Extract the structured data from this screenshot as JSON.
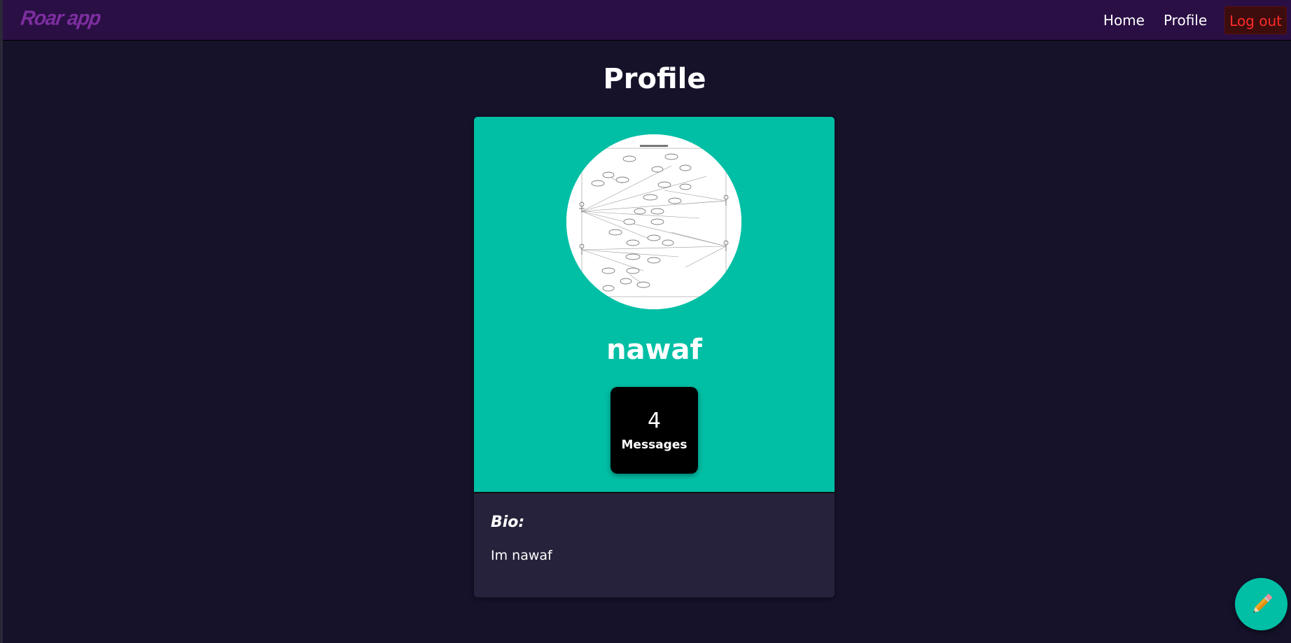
{
  "navbar": {
    "brand": "Roar app",
    "links": [
      {
        "label": "Home"
      },
      {
        "label": "Profile"
      }
    ],
    "logout_label": "Log out"
  },
  "page": {
    "title": "Profile"
  },
  "profile": {
    "username": "nawaf",
    "avatar_icon": "diagram-image",
    "stats": {
      "count": "4",
      "label": "Messages"
    },
    "bio_heading": "Bio:",
    "bio_text": "Im nawaf"
  },
  "fab": {
    "icon": "pencil-icon"
  },
  "colors": {
    "navbar_bg": "#2a0f45",
    "page_bg": "#15122a",
    "brand": "#7d2ea0",
    "card_accent": "#00bfa5",
    "bio_bg": "#26223b",
    "logout_text": "#ff2a2a",
    "logout_bg": "#3d0d0d"
  }
}
